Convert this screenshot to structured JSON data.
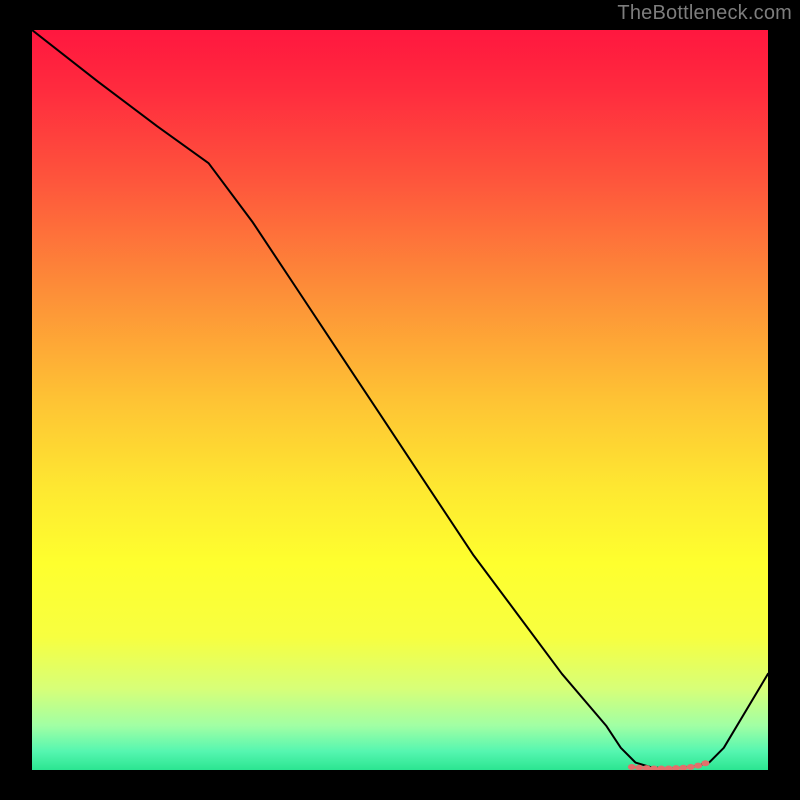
{
  "watermark": "TheBottleneck.com",
  "chart_data": {
    "type": "line",
    "title": "",
    "xlabel": "",
    "ylabel": "",
    "xlim": [
      0,
      100
    ],
    "ylim": [
      0,
      100
    ],
    "grid": false,
    "legend": false,
    "annotations": [],
    "note": "Axes and ticks are not labeled in the image; x/y mapped to 0-100% of plot width/height. Background is a vertical gradient red→yellow→green (top→bottom).",
    "series": [
      {
        "name": "curve",
        "color": "#000000",
        "x": [
          0,
          9,
          17,
          24,
          30,
          36,
          42,
          48,
          54,
          60,
          66,
          72,
          78,
          80,
          82,
          84,
          86,
          88,
          90,
          92,
          94,
          100
        ],
        "y": [
          100,
          93,
          87,
          82,
          74,
          65,
          56,
          47,
          38,
          29,
          21,
          13,
          6,
          3,
          1,
          0.4,
          0.2,
          0.3,
          0.5,
          1,
          3,
          13
        ]
      },
      {
        "name": "optimal-band-markers",
        "color": "#e2706b",
        "style": "points",
        "x": [
          81.5,
          82.5,
          83.5,
          84.5,
          85.5,
          86.5,
          87.5,
          88.5,
          89.5,
          90.5,
          91.5
        ],
        "y": [
          0.4,
          0.3,
          0.25,
          0.2,
          0.2,
          0.2,
          0.25,
          0.3,
          0.4,
          0.6,
          0.9
        ]
      }
    ],
    "gradient_stops": [
      {
        "offset": 0.0,
        "color": "#ff173f"
      },
      {
        "offset": 0.08,
        "color": "#ff2b3e"
      },
      {
        "offset": 0.2,
        "color": "#fe543c"
      },
      {
        "offset": 0.35,
        "color": "#fd8d38"
      },
      {
        "offset": 0.5,
        "color": "#fec334"
      },
      {
        "offset": 0.62,
        "color": "#fee831"
      },
      {
        "offset": 0.72,
        "color": "#feff2e"
      },
      {
        "offset": 0.82,
        "color": "#f7ff40"
      },
      {
        "offset": 0.89,
        "color": "#d7ff78"
      },
      {
        "offset": 0.94,
        "color": "#a1ffa4"
      },
      {
        "offset": 0.975,
        "color": "#55f6b0"
      },
      {
        "offset": 1.0,
        "color": "#2be591"
      }
    ]
  }
}
